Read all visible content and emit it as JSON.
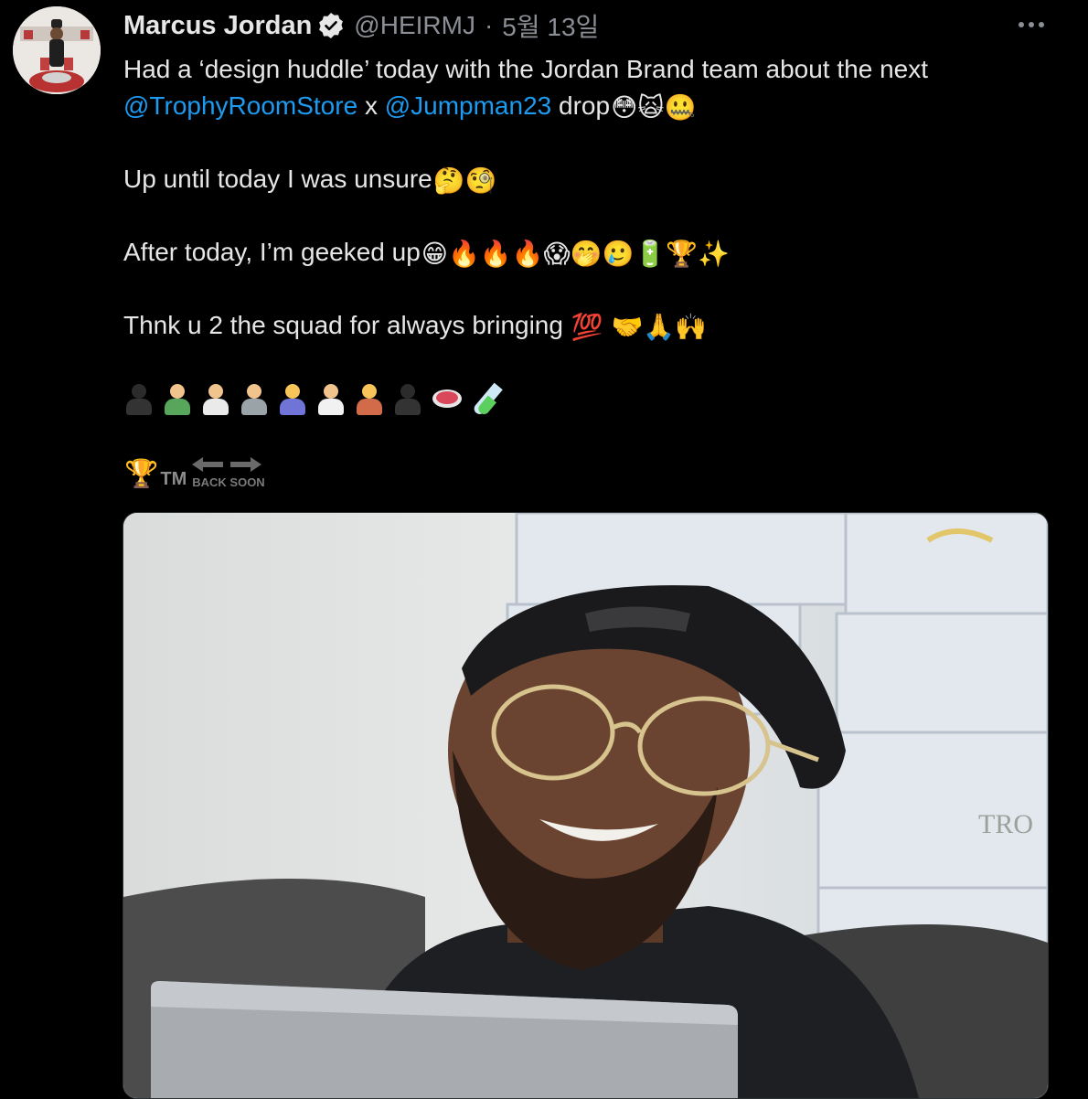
{
  "tweet": {
    "author_name": "Marcus Jordan",
    "handle": "@HEIRMJ",
    "separator": "·",
    "date": "5월 13일",
    "lines": {
      "l1": "Had a ‘design huddle’ today with the Jordan Brand team about the next",
      "l2_mention_a": "@TrophyRoomStore",
      "l2_x": "x",
      "l2_mention_b": "@Jumpman23",
      "l2_tail": "drop",
      "l3": "Up until today I was unsure",
      "l4": "After today, I’m geeked up",
      "l5": "Thnk u 2 the squad for always bringing"
    },
    "emoji": {
      "l2": "😳🙀🤐",
      "l3": "🤔🧐",
      "l4": "😁🔥🔥🔥😱🤭🥲🔋🏆✨",
      "l5": "💯 🤝🙏🙌"
    },
    "signature": {
      "trophy": "🏆",
      "tm": "TM",
      "back_soon": "BACK SOON"
    }
  },
  "media": {
    "box_text": "TRO"
  },
  "icons": {
    "verified": "verified-badge-icon",
    "more": "more-dots-icon",
    "arrows": "left-right-arrow-icon"
  },
  "colors": {
    "background": "#000000",
    "text": "#e6e6e6",
    "muted": "#8b8f95",
    "link": "#1d9bf0"
  }
}
